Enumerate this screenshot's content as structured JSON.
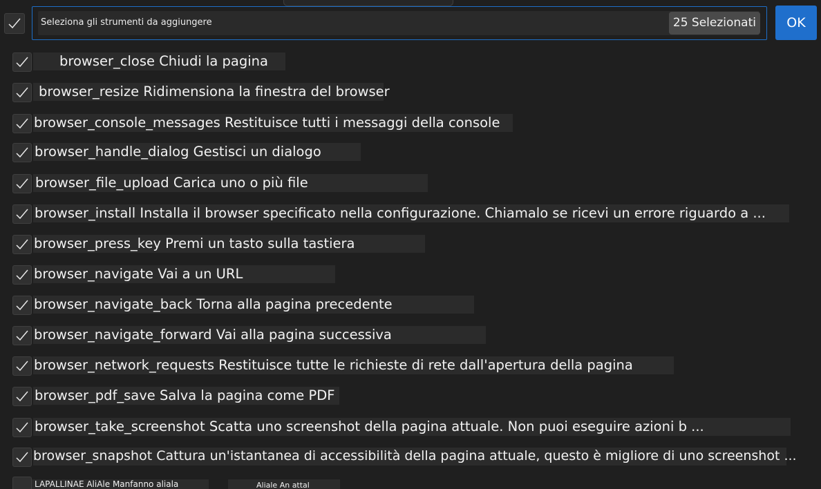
{
  "header": {
    "select_all_checked": true,
    "search_placeholder": "Seleziona gli strumenti da aggiungere",
    "selected_count_label": "25 Selezionati",
    "ok_label": "OK"
  },
  "colors": {
    "accent": "#1f6fcc",
    "background": "#1f1f1f",
    "item_background": "#2b2b2b",
    "checkbox_background": "#303030"
  },
  "items": [
    {
      "label": "browser_close Chiudi la pagina",
      "checked": true
    },
    {
      "label": "browser_resize Ridimensiona la finestra del browser",
      "checked": true
    },
    {
      "label": "browser_console_messages Restituisce tutti i messaggi della console",
      "checked": true
    },
    {
      "label": "browser_handle_dialog Gestisci un dialogo",
      "checked": true
    },
    {
      "label": "browser_file_upload Carica uno o più file",
      "checked": true
    },
    {
      "label": "browser_install Installa il browser specificato nella configurazione. Chiamalo se ricevi un errore riguardo a ...",
      "checked": true
    },
    {
      "label": "browser_press_key Premi un tasto sulla tastiera",
      "checked": true
    },
    {
      "label": "browser_navigate Vai a un URL",
      "checked": true
    },
    {
      "label": "browser_navigate_back Torna alla pagina precedente",
      "checked": true
    },
    {
      "label": "browser_navigate_forward Vai alla pagina successiva",
      "checked": true
    },
    {
      "label": "browser_network_requests Restituisce tutte le richieste di rete dall'apertura della pagina",
      "checked": true
    },
    {
      "label": "browser_pdf_save Salva la pagina come PDF",
      "checked": true
    },
    {
      "label": "browser_take_screenshot Scatta uno screenshot della pagina attuale. Non puoi eseguire azioni b ...",
      "checked": true
    },
    {
      "label": "browser_snapshot Cattura un'istantanea di accessibilità della pagina attuale, questo è migliore di uno screenshot ...",
      "checked": true
    }
  ],
  "partial_item": {
    "label_left": "LAPALLINAE AliAle Manfanno aliala",
    "label_right": "Aliale An attal"
  }
}
